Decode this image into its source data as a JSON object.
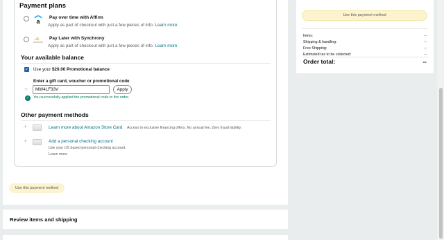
{
  "payment_plans": {
    "heading": "Payment plans",
    "plans": [
      {
        "logo": "affirm-logo-icon",
        "title": "Pay over time with Affirm",
        "desc": "Apply as part of checkout with just a few pieces of info.",
        "link": "Learn more"
      },
      {
        "logo": "synchrony-logo-icon",
        "title": "Pay Later with Synchrony",
        "desc": "Apply as part of checkout with just a few pieces of info.",
        "link": "Learn more"
      }
    ]
  },
  "balance": {
    "heading": "Your available balance",
    "promo_prefix": "Use your ",
    "promo_amount": "$20.00 Promotional balance",
    "promo_checked": true,
    "gift_label": "Enter a gift card, voucher or promotional code",
    "code_value": "MW4LF33V",
    "apply_label": "Apply",
    "success_text": "You successfully applied the promotional code to the order."
  },
  "other_methods": {
    "heading": "Other payment methods",
    "store_card": {
      "title": "Learn more about Amazon Store Card",
      "desc": "Access to exclusive financing offers. No annual fee. Zero fraud liability."
    },
    "checking": {
      "title": "Add a personal checking account",
      "desc": "Use your US based personal checking account.",
      "link": "Learn more"
    }
  },
  "use_payment_label": "Use this payment method",
  "review": {
    "title": "Review items and shipping"
  },
  "summary": {
    "button": "Use this payment method",
    "rows": [
      {
        "label": "Items:",
        "value": "--"
      },
      {
        "label": "Shipping & handling:",
        "value": "--"
      },
      {
        "label": "Free Shipping:",
        "value": "--"
      },
      {
        "label": "Estimated tax to be collected:",
        "value": "--"
      }
    ],
    "total_label": "Order total:",
    "total_value": "--"
  },
  "colors": {
    "link": "#007185",
    "accent_yellow": "#fcf4cf",
    "success": "#067d62",
    "checkbox": "#2162a1"
  }
}
